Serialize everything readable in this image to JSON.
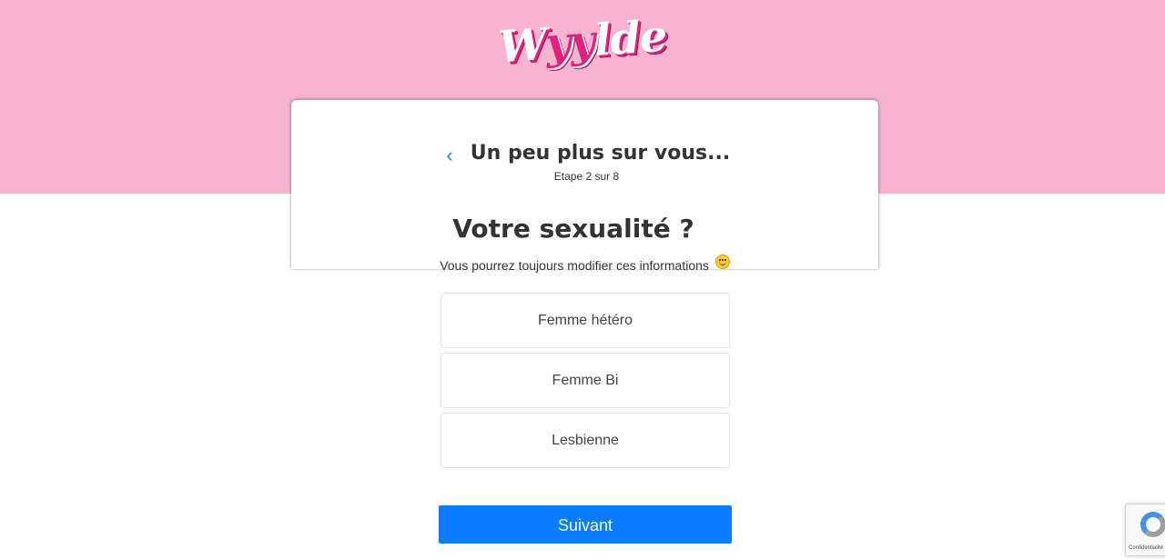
{
  "brand": {
    "logo_part1": "W",
    "logo_part2": "yy",
    "logo_part3": "lde",
    "colors": {
      "pink_background": "#f7b4cf",
      "logo_magenta": "#e0227f",
      "primary_button": "#0a7cff",
      "back_arrow": "#1f7fd1"
    }
  },
  "header": {
    "back_icon": "chevron-left-icon",
    "back_glyph": "‹",
    "title": "Un peu plus sur vous...",
    "step_label": "Etape 2 sur 8"
  },
  "question": {
    "title": "Votre sexualité ?",
    "hint": "Vous pourrez toujours modifier ces informations",
    "hint_icon": "smiling-face-emoji-icon"
  },
  "options": [
    {
      "label": "Femme hétéro"
    },
    {
      "label": "Femme Bi"
    },
    {
      "label": "Lesbienne"
    }
  ],
  "actions": {
    "next_label": "Suivant"
  },
  "recaptcha": {
    "icon": "recaptcha-icon",
    "text": "Confidentialité - Conditions"
  }
}
